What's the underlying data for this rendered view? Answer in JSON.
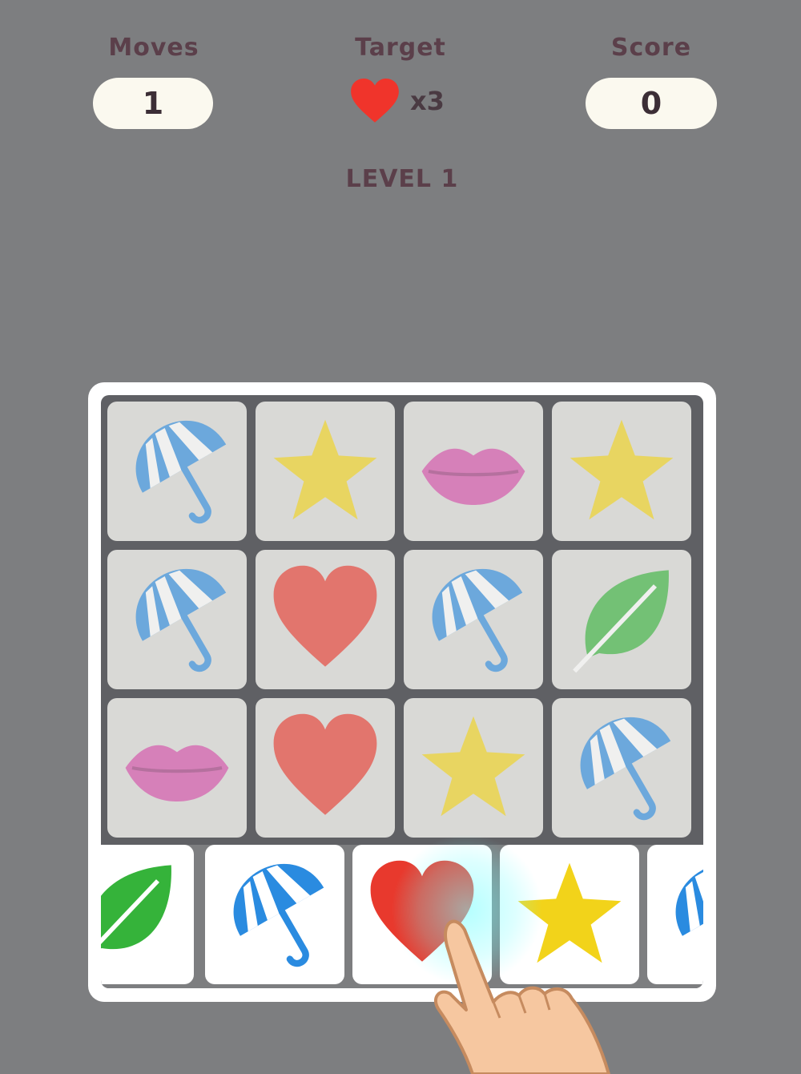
{
  "hud": {
    "moves_label": "Moves",
    "moves_value": "1",
    "target_label": "Target",
    "target_icon": "heart-icon",
    "target_count": "x3",
    "score_label": "Score",
    "score_value": "0"
  },
  "level": "LEVEL 1",
  "board": {
    "rows": [
      [
        "umbrella",
        "star",
        "lips",
        "star"
      ],
      [
        "umbrella",
        "heart",
        "umbrella",
        "leaf"
      ],
      [
        "lips",
        "heart",
        "star",
        "umbrella"
      ]
    ],
    "tray": [
      "leaf",
      "umbrella",
      "heart",
      "star",
      "umbrella"
    ]
  },
  "colors": {
    "background": "#7d7e80",
    "heart": "#e8392d",
    "star": "#f2d31a",
    "umbrella": "#2a8be0",
    "leaf": "#35b33a",
    "lips": "#d54aa8",
    "hud_text": "#5b3f4a"
  },
  "hint": {
    "icon": "pointing-hand-icon"
  }
}
